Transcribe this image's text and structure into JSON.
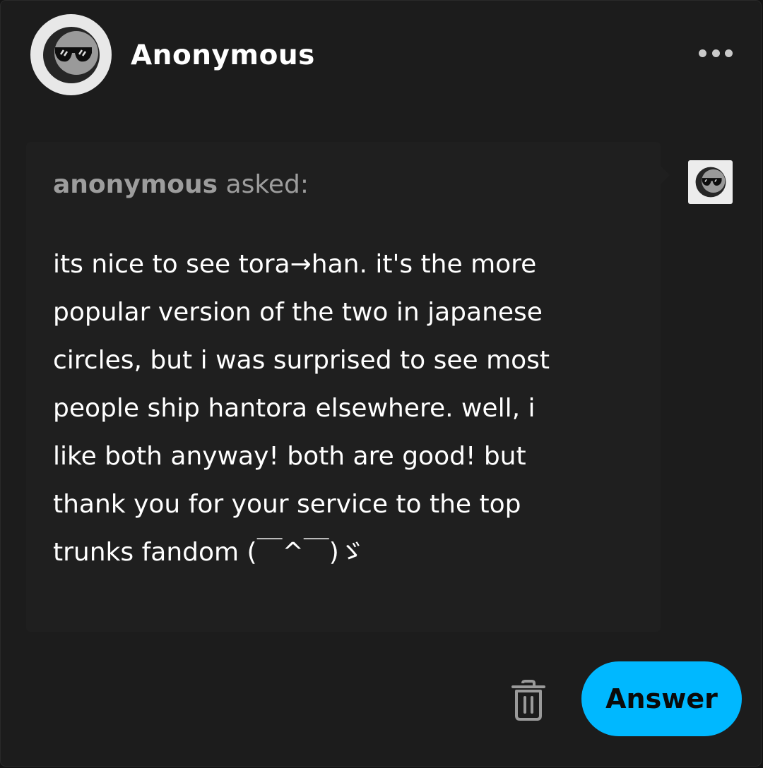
{
  "post": {
    "username": "Anonymous",
    "asker_name": "anonymous",
    "asked_label": "asked:",
    "question_lines": [
      "its nice to see tora→han. it's the more",
      "popular version of the two in japanese",
      "circles, but i was surprised to see most",
      "people ship hantora elsewhere. well, i",
      "like both anyway! both are good! but",
      "thank you for your service to the top",
      "trunks fandom (￣^￣)ゞ"
    ]
  },
  "actions": {
    "answer_label": "Answer"
  },
  "icons": {
    "avatar": "anonymous-sunglasses-avatar",
    "more": "more-horizontal-icon",
    "trash": "trash-icon"
  },
  "colors": {
    "accent": "#00b8ff",
    "card_bg": "#1c1c1c",
    "ask_box_bg": "#1f1f1f",
    "muted_text": "#9d9d9d"
  }
}
